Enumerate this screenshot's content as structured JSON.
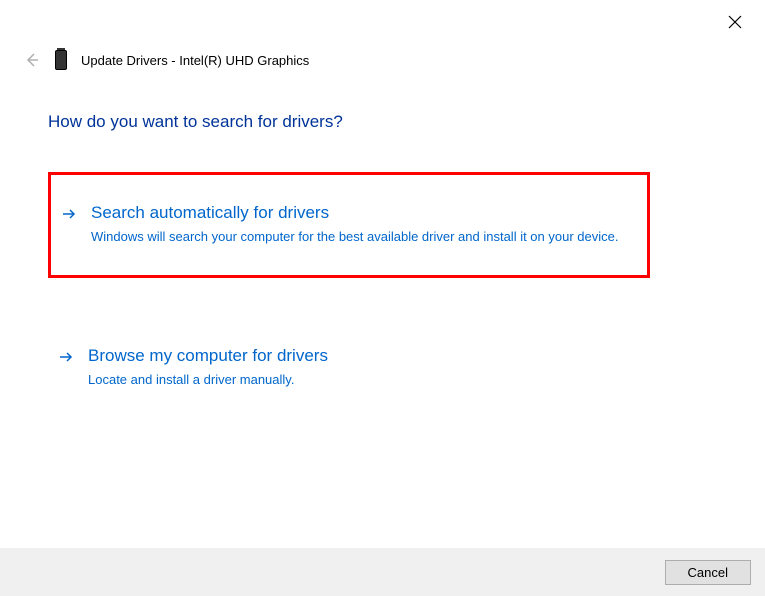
{
  "window": {
    "title": "Update Drivers - Intel(R) UHD Graphics"
  },
  "heading": "How do you want to search for drivers?",
  "options": [
    {
      "title": "Search automatically for drivers",
      "description": "Windows will search your computer for the best available driver and install it on your device."
    },
    {
      "title": "Browse my computer for drivers",
      "description": "Locate and install a driver manually."
    }
  ],
  "footer": {
    "cancel_label": "Cancel"
  }
}
